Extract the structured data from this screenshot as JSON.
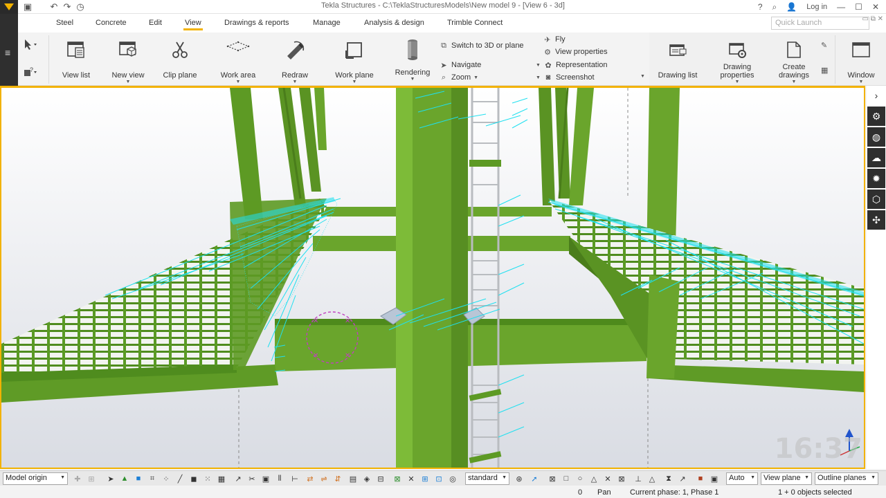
{
  "titlebar": {
    "title": "Tekla Structures - C:\\TeklaStructuresModels\\New model 9 - [View 6 - 3d]",
    "login": "Log in"
  },
  "menu": {
    "tabs": [
      "Steel",
      "Concrete",
      "Edit",
      "View",
      "Drawings & reports",
      "Manage",
      "Analysis & design",
      "Trimble Connect"
    ],
    "active_tab": "View",
    "quick_launch_placeholder": "Quick Launch"
  },
  "ribbon": {
    "view_list": "View list",
    "new_view": "New view",
    "clip_plane": "Clip plane",
    "work_area": "Work area",
    "redraw": "Redraw",
    "work_plane": "Work plane",
    "rendering": "Rendering",
    "switch_3d": "Switch to 3D or plane",
    "navigate": "Navigate",
    "zoom": "Zoom",
    "fly": "Fly",
    "view_properties": "View properties",
    "representation": "Representation",
    "screenshot": "Screenshot",
    "drawing_list": "Drawing list",
    "drawing_properties_1": "Drawing",
    "drawing_properties_2": "properties",
    "create_drawings_1": "Create",
    "create_drawings_2": "drawings",
    "window": "Window"
  },
  "viewport": {
    "clock": "16:37"
  },
  "toolbar": {
    "model_origin": "Model origin",
    "standard": "standard",
    "auto": "Auto",
    "view_plane": "View plane",
    "outline_planes": "Outline planes"
  },
  "status": {
    "count": "0",
    "mode": "Pan",
    "phase": "Current phase: 1, Phase 1",
    "selection": "1 + 0 objects selected"
  },
  "colors": {
    "accent": "#f2b200",
    "steel_green": "#6aa52c",
    "highlight_cyan": "#1fe0f0"
  }
}
